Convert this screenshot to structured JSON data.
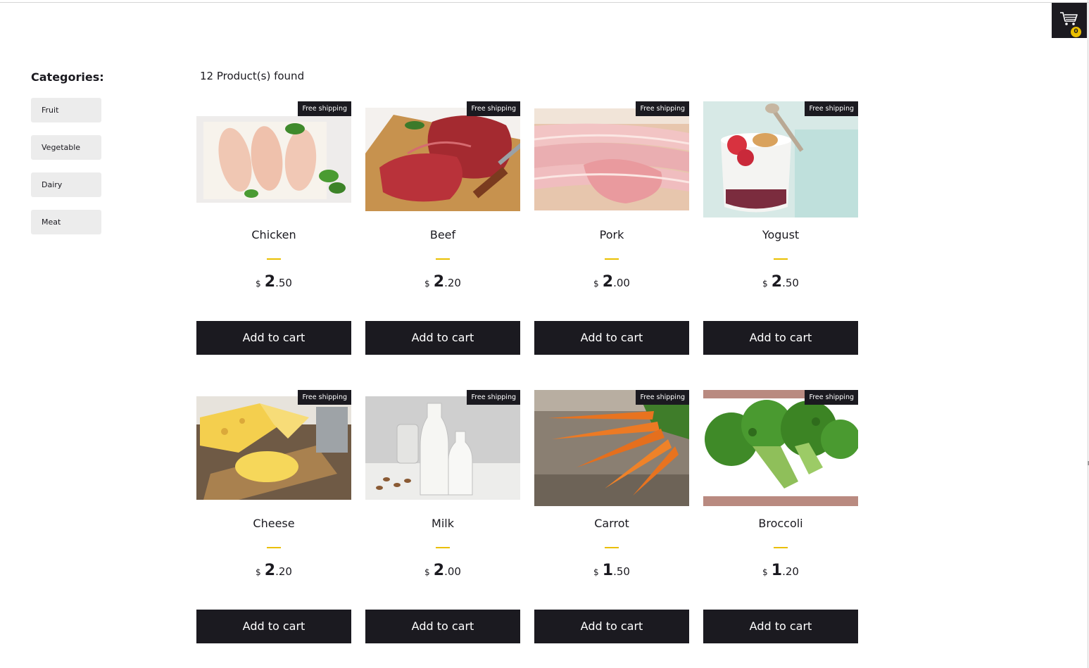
{
  "cart": {
    "count": "0",
    "icon": "cart-icon"
  },
  "sidebar": {
    "title": "Categories:",
    "items": [
      {
        "label": "Fruit"
      },
      {
        "label": "Vegetable"
      },
      {
        "label": "Dairy"
      },
      {
        "label": "Meat"
      }
    ]
  },
  "main": {
    "products_found": "12 Product(s) found",
    "products": [
      {
        "name": "Chicken",
        "badge": "Free shipping",
        "currency": "$",
        "price_int": "2",
        "price_dec": ".50",
        "button": "Add to cart"
      },
      {
        "name": "Beef",
        "badge": "Free shipping",
        "currency": "$",
        "price_int": "2",
        "price_dec": ".20",
        "button": "Add to cart"
      },
      {
        "name": "Pork",
        "badge": "Free shipping",
        "currency": "$",
        "price_int": "2",
        "price_dec": ".00",
        "button": "Add to cart"
      },
      {
        "name": "Yogust",
        "badge": "Free shipping",
        "currency": "$",
        "price_int": "2",
        "price_dec": ".50",
        "button": "Add to cart"
      },
      {
        "name": "Cheese",
        "badge": "Free shipping",
        "currency": "$",
        "price_int": "2",
        "price_dec": ".20",
        "button": "Add to cart"
      },
      {
        "name": "Milk",
        "badge": "Free shipping",
        "currency": "$",
        "price_int": "2",
        "price_dec": ".00",
        "button": "Add to cart"
      },
      {
        "name": "Carrot",
        "badge": "Free shipping",
        "currency": "$",
        "price_int": "1",
        "price_dec": ".50",
        "button": "Add to cart"
      },
      {
        "name": "Broccoli",
        "badge": "Free shipping",
        "currency": "$",
        "price_int": "1",
        "price_dec": ".20",
        "button": "Add to cart"
      }
    ]
  },
  "colors": {
    "dark": "#1b1a20",
    "accent": "#eabf00",
    "category_bg": "#ececec"
  }
}
